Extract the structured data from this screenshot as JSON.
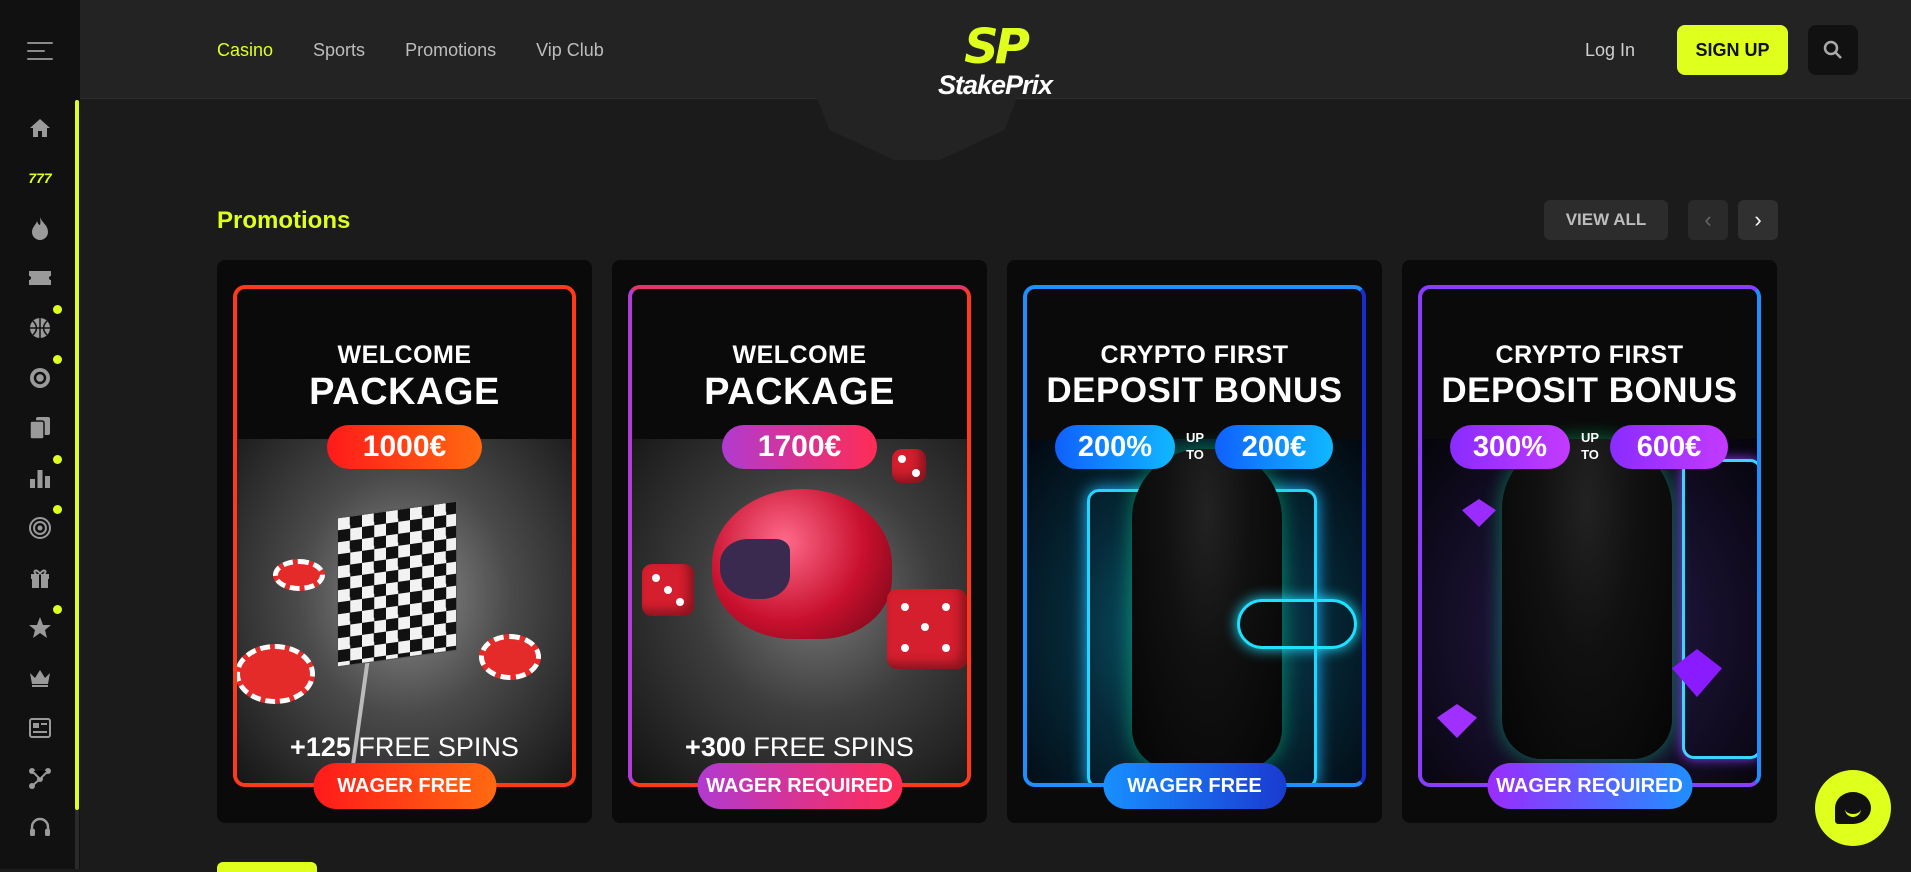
{
  "header": {
    "nav": [
      {
        "label": "Casino",
        "active": true
      },
      {
        "label": "Sports",
        "active": false
      },
      {
        "label": "Promotions",
        "active": false
      },
      {
        "label": "Vip Club",
        "active": false
      }
    ],
    "logo_mark": "SP",
    "logo_name": "StakePrix",
    "login_label": "Log In",
    "signup_label": "SIGN UP"
  },
  "sidebar": {
    "icons": [
      "menu-icon",
      "home-icon",
      "slots-777-icon",
      "fire-icon",
      "ticket-icon",
      "basketball-icon",
      "chip-icon",
      "cards-icon",
      "chart-icon",
      "target-icon",
      "gift-icon",
      "star-icon",
      "crown-icon",
      "news-icon",
      "network-icon",
      "support-headset-icon"
    ],
    "active_badge": "777"
  },
  "promotions": {
    "title": "Promotions",
    "view_all_label": "VIEW ALL",
    "cards": [
      {
        "line1": "WELCOME",
        "line2": "PACKAGE",
        "amount": "1000€",
        "spins_num": "+125",
        "spins_text": "FREE SPINS",
        "wager": "WAGER FREE"
      },
      {
        "line1": "WELCOME",
        "line2": "PACKAGE",
        "amount": "1700€",
        "spins_num": "+300",
        "spins_text": "FREE SPINS",
        "wager": "WAGER REQUIRED"
      },
      {
        "line1": "CRYPTO FIRST",
        "line2": "DEPOSIT BONUS",
        "percent": "200%",
        "upto": "UP TO",
        "amount": "200€",
        "wager": "WAGER FREE"
      },
      {
        "line1": "CRYPTO FIRST",
        "line2": "DEPOSIT BONUS",
        "percent": "300%",
        "upto": "UP TO",
        "amount": "600€",
        "wager": "WAGER REQUIRED"
      }
    ]
  },
  "colors": {
    "accent": "#dfff1c",
    "background": "#1b1b1b",
    "sidebar": "#111111"
  }
}
